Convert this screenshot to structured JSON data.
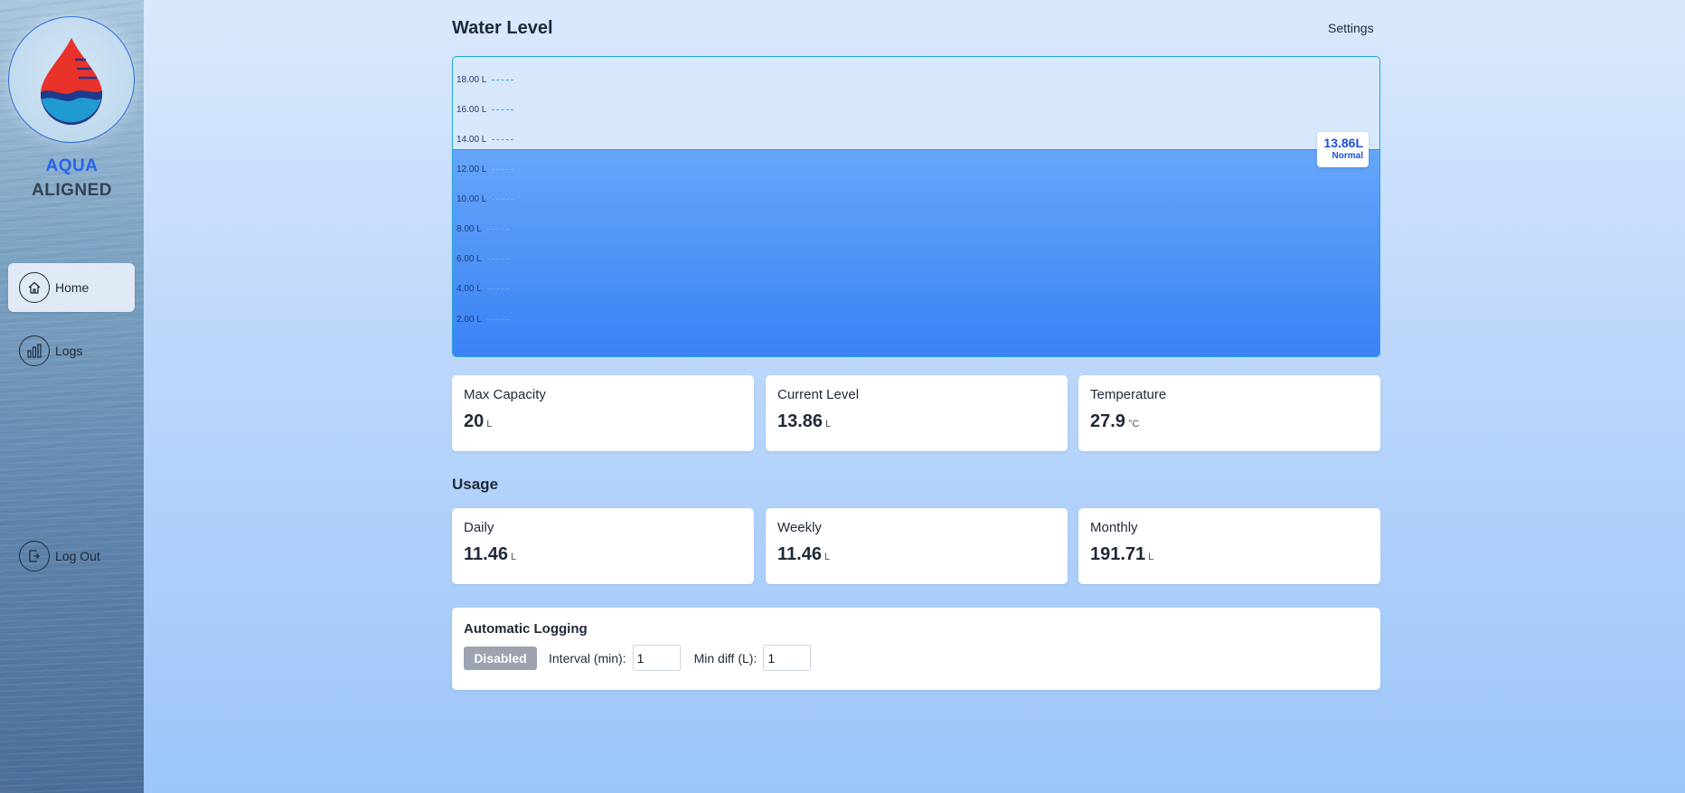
{
  "sidebar": {
    "brand_line1": "AQUA",
    "brand_line2": "ALIGNED",
    "items": [
      {
        "label": "Home",
        "icon": "home-icon",
        "active": true
      },
      {
        "label": "Logs",
        "icon": "bar-chart-icon",
        "active": false
      },
      {
        "label": "Log Out",
        "icon": "logout-icon",
        "active": false
      }
    ]
  },
  "header": {
    "title": "Water Level",
    "settings_label": "Settings"
  },
  "tank": {
    "ticks": [
      "18.00 L",
      "16.00 L",
      "14.00 L",
      "12.00 L",
      "10.00 L",
      "8.00 L",
      "6.00 L",
      "4.00 L",
      "2.00 L"
    ],
    "fill_fraction": 0.693,
    "current_value": "13.86L",
    "status": "Normal",
    "colors": {
      "water": "#3b82f6",
      "border": "#22a3d6"
    }
  },
  "stats": [
    {
      "label": "Max Capacity",
      "value": "20",
      "unit": "L"
    },
    {
      "label": "Current Level",
      "value": "13.86",
      "unit": "L"
    },
    {
      "label": "Temperature",
      "value": "27.9",
      "unit": "°C"
    }
  ],
  "usage": {
    "title": "Usage",
    "cards": [
      {
        "label": "Daily",
        "value": "11.46",
        "unit": "L"
      },
      {
        "label": "Weekly",
        "value": "11.46",
        "unit": "L"
      },
      {
        "label": "Monthly",
        "value": "191.71",
        "unit": "L"
      }
    ]
  },
  "logging": {
    "title": "Automatic Logging",
    "toggle_label": "Disabled",
    "interval_label": "Interval (min):",
    "interval_value": "1",
    "mindiff_label": "Min diff (L):",
    "mindiff_value": "1"
  }
}
